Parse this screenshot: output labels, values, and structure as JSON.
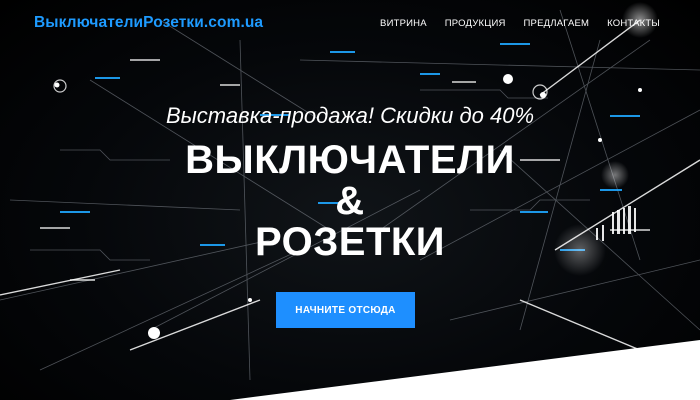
{
  "header": {
    "logo": "ВыключателиРозетки.com.ua",
    "nav": [
      "ВИТРИНА",
      "ПРОДУКЦИЯ",
      "ПРЕДЛАГАЕМ",
      "КОНТАКТЫ"
    ]
  },
  "hero": {
    "tagline": "Выставка-продажа! Скидки до 40%",
    "title_line1": "ВЫКЛЮЧАТЕЛИ",
    "title_line2": "&",
    "title_line3": "РОЗЕТКИ",
    "cta_label": "НАЧНИТЕ ОТСЮДА"
  },
  "colors": {
    "accent": "#1e8fff",
    "logo": "#1e9bff",
    "background": "#000000"
  }
}
